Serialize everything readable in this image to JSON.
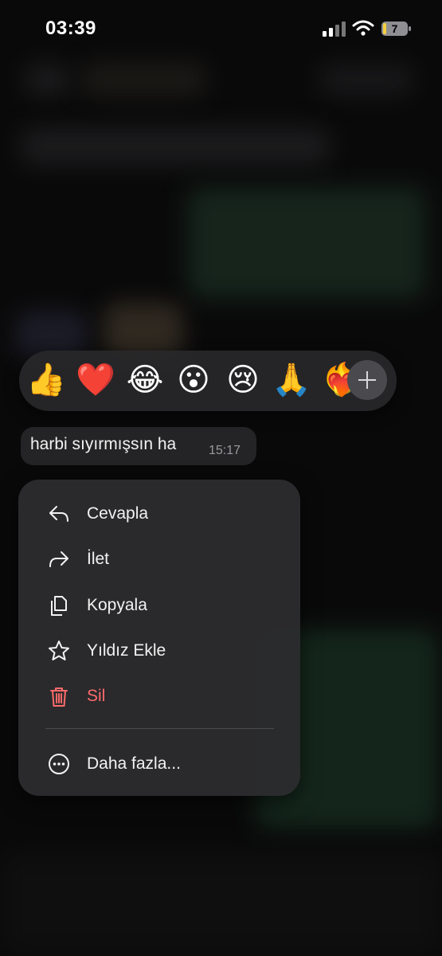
{
  "status_bar": {
    "time": "03:39",
    "battery": "7"
  },
  "reactions": {
    "emojis": [
      "👍",
      "❤️",
      "😂",
      "😮",
      "😢",
      "🙏",
      "❤️‍🔥"
    ],
    "more_icon": "plus-icon"
  },
  "message": {
    "text": "harbi sıyırmışsın ha",
    "time": "15:17"
  },
  "menu": {
    "items": [
      {
        "label": "Cevapla",
        "icon": "reply-icon"
      },
      {
        "label": "İlet",
        "icon": "forward-icon"
      },
      {
        "label": "Kopyala",
        "icon": "copy-icon"
      },
      {
        "label": "Yıldız Ekle",
        "icon": "star-icon"
      },
      {
        "label": "Sil",
        "icon": "trash-icon"
      },
      {
        "label": "Daha fazla...",
        "icon": "more-circle-icon"
      }
    ]
  },
  "colors": {
    "danger": "#ff6b6b",
    "menu_bg": "#2c2c2e"
  }
}
